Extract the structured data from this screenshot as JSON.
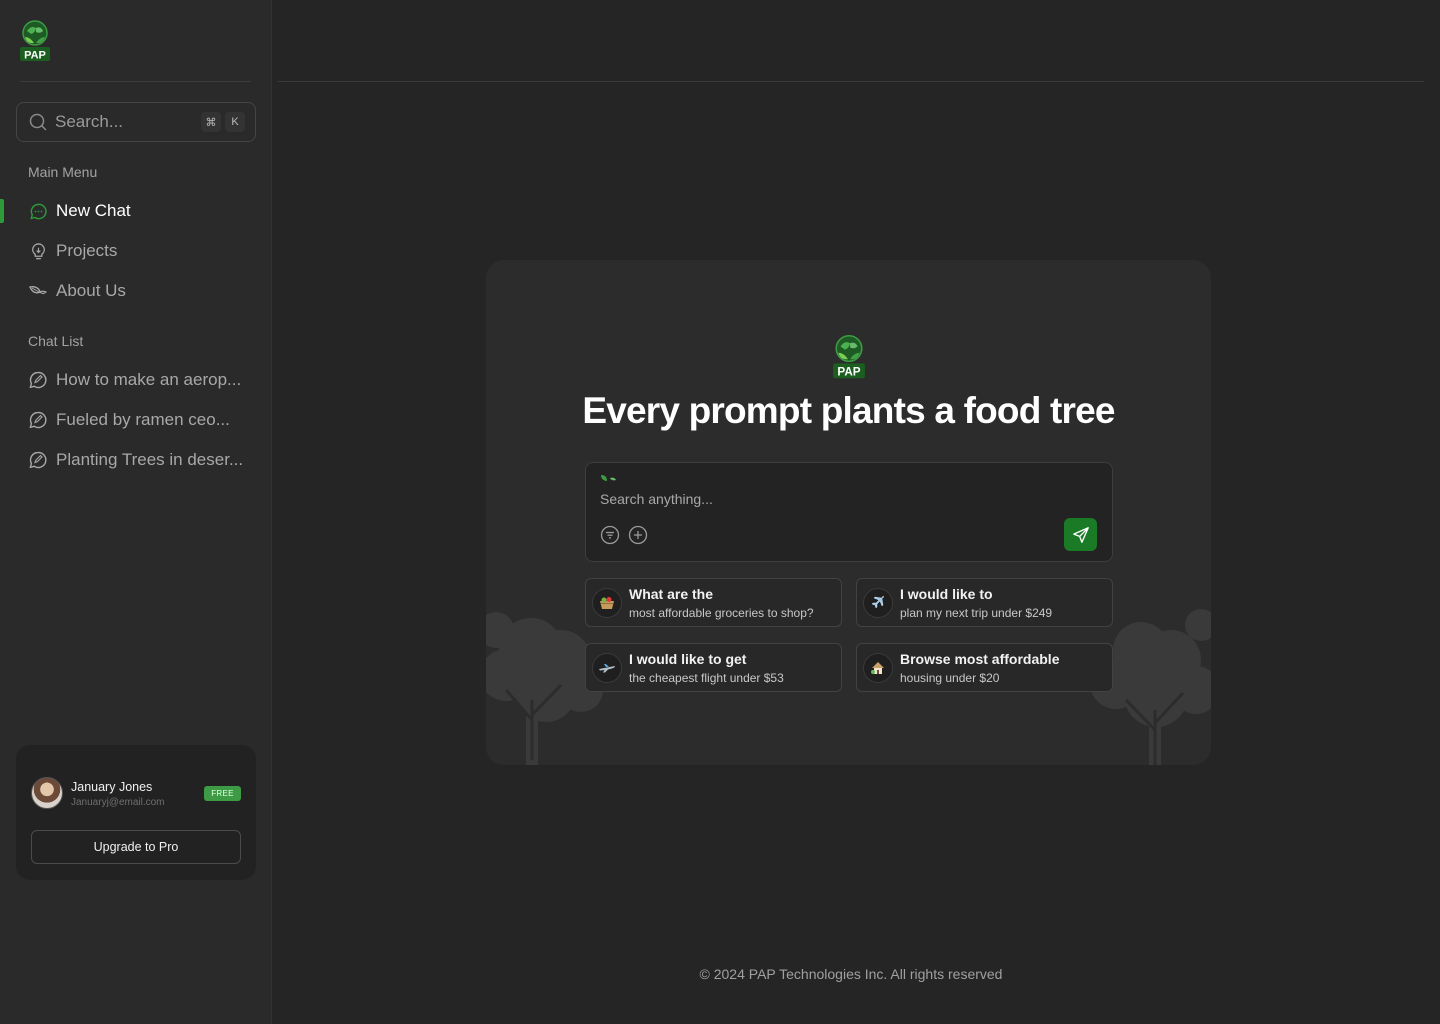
{
  "brand": {
    "logo_text": "PAP",
    "accent": "#2e9a3a",
    "send_green": "#1a7a26"
  },
  "sidebar": {
    "search": {
      "placeholder": "Search...",
      "shortcut_keys": [
        "⌘",
        "K"
      ]
    },
    "main_menu_label": "Main Menu",
    "menu_items": [
      {
        "label": "New Chat",
        "icon": "chat-bubble-icon",
        "active": true
      },
      {
        "label": "Projects",
        "icon": "lightbulb-icon",
        "active": false
      },
      {
        "label": "About Us",
        "icon": "leaf-icon",
        "active": false
      }
    ],
    "chat_list_label": "Chat List",
    "chats": [
      {
        "label": "How to make an aerop...",
        "icon": "chat-edit-icon"
      },
      {
        "label": "Fueled by ramen ceo...",
        "icon": "chat-edit-icon"
      },
      {
        "label": "Planting Trees in deser...",
        "icon": "chat-edit-icon"
      }
    ],
    "profile": {
      "name": "January Jones",
      "email": "Januaryj@email.com",
      "plan_badge": "FREE",
      "upgrade_label": "Upgrade to Pro"
    }
  },
  "main": {
    "title": "Every prompt plants a food tree",
    "prompt": {
      "placeholder": "Search anything..."
    },
    "suggestions": [
      {
        "title": "What are the",
        "subtitle": "most affordable groceries to shop?",
        "icon": "grocery-basket-icon"
      },
      {
        "title": "I would like to",
        "subtitle": "plan my next trip under $249",
        "icon": "airplane-icon"
      },
      {
        "title": "I would like to get",
        "subtitle": "the cheapest flight under $53",
        "icon": "jet-icon"
      },
      {
        "title": "Browse most affordable",
        "subtitle": "housing under $20",
        "icon": "house-icon"
      }
    ]
  },
  "footer": {
    "copyright": "© 2024 PAP Technologies Inc. All rights reserved"
  }
}
